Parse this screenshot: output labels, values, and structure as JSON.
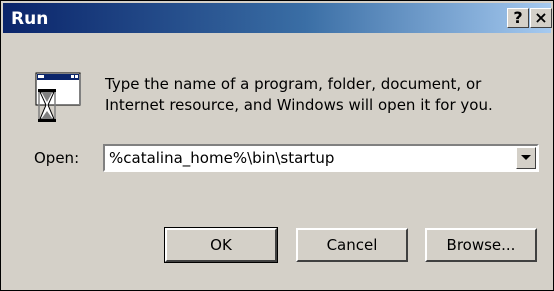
{
  "window": {
    "title": "Run",
    "help_label": "?",
    "close_label": "×"
  },
  "prompt": {
    "line1": "Type the name of a program, folder, document, or",
    "line2": "Internet resource, and Windows will open it for you."
  },
  "open": {
    "label": "Open:",
    "value": "%catalina_home%\\bin\\startup"
  },
  "buttons": {
    "ok": "OK",
    "cancel": "Cancel",
    "browse": "Browse..."
  },
  "icons": {
    "run_icon": "run-window-hourglass-icon",
    "dropdown": "chevron-down-icon"
  },
  "colors": {
    "title_start": "#0a246a",
    "title_end": "#a6caf0",
    "face": "#d4d0c8"
  }
}
